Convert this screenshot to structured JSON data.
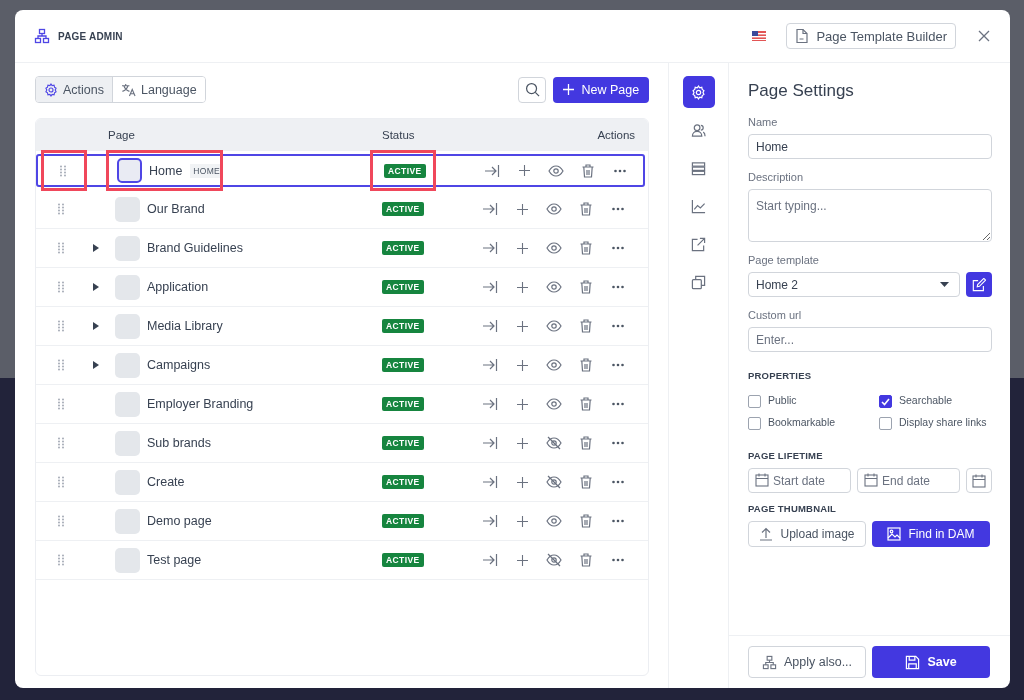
{
  "header": {
    "title": "PAGE ADMIN",
    "builder_button": "Page Template Builder"
  },
  "toolbar": {
    "tabs": [
      {
        "label": "Actions",
        "selected": true
      },
      {
        "label": "Language",
        "selected": false
      }
    ],
    "new_button": "New Page"
  },
  "table": {
    "columns": [
      "Page",
      "Status",
      "Actions"
    ],
    "rows": [
      {
        "name": "Home",
        "badge": "HOME",
        "status": "ACTIVE",
        "selected": true,
        "visible": true,
        "annotated": true
      },
      {
        "name": "Our Brand",
        "status": "ACTIVE",
        "selected": false,
        "visible": true,
        "annotated": false
      },
      {
        "name": "Brand Guidelines",
        "status": "ACTIVE",
        "selected": false,
        "visible": true,
        "annotated": false,
        "expanded": false
      },
      {
        "name": "Application",
        "status": "ACTIVE",
        "selected": false,
        "visible": true,
        "annotated": false,
        "expanded": false
      },
      {
        "name": "Media Library",
        "status": "ACTIVE",
        "selected": false,
        "visible": true,
        "annotated": false,
        "expanded": false
      },
      {
        "name": "Campaigns",
        "status": "ACTIVE",
        "selected": false,
        "visible": true,
        "annotated": false,
        "expanded": false
      },
      {
        "name": "Employer Branding",
        "status": "ACTIVE",
        "selected": false,
        "visible": true,
        "annotated": false
      },
      {
        "name": "Sub brands",
        "status": "ACTIVE",
        "selected": false,
        "visible": false,
        "annotated": false
      },
      {
        "name": "Create",
        "status": "ACTIVE",
        "selected": false,
        "visible": false,
        "annotated": false
      },
      {
        "name": "Demo page",
        "status": "ACTIVE",
        "selected": false,
        "visible": true,
        "annotated": false
      },
      {
        "name": "Test page",
        "status": "ACTIVE",
        "selected": false,
        "visible": false,
        "annotated": false
      }
    ]
  },
  "side_tabs": [
    {
      "kind": "settings",
      "selected": true
    },
    {
      "kind": "users",
      "selected": false
    },
    {
      "kind": "list",
      "selected": false
    },
    {
      "kind": "chart",
      "selected": false
    },
    {
      "kind": "external",
      "selected": false
    },
    {
      "kind": "copy",
      "selected": false
    }
  ],
  "settings": {
    "title": "Page Settings",
    "name": {
      "label": "Name",
      "value": "Home"
    },
    "description": {
      "label": "Description",
      "placeholder": "Start typing..."
    },
    "template": {
      "label": "Page template",
      "value": "Home 2"
    },
    "custom_url": {
      "label": "Custom url",
      "placeholder": "Enter..."
    },
    "properties_heading": "PROPERTIES",
    "properties": [
      {
        "label": "Public",
        "checked": false
      },
      {
        "label": "Searchable",
        "checked": true
      },
      {
        "label": "Bookmarkable",
        "checked": false
      },
      {
        "label": "Display share links",
        "checked": false
      }
    ],
    "lifetime_heading": "PAGE LIFETIME",
    "start_placeholder": "Start date",
    "end_placeholder": "End date",
    "thumbnail_heading": "PAGE THUMBNAIL",
    "upload_button": "Upload image",
    "dam_button": "Find in DAM"
  },
  "footer": {
    "apply_button": "Apply also...",
    "save_button": "Save"
  }
}
